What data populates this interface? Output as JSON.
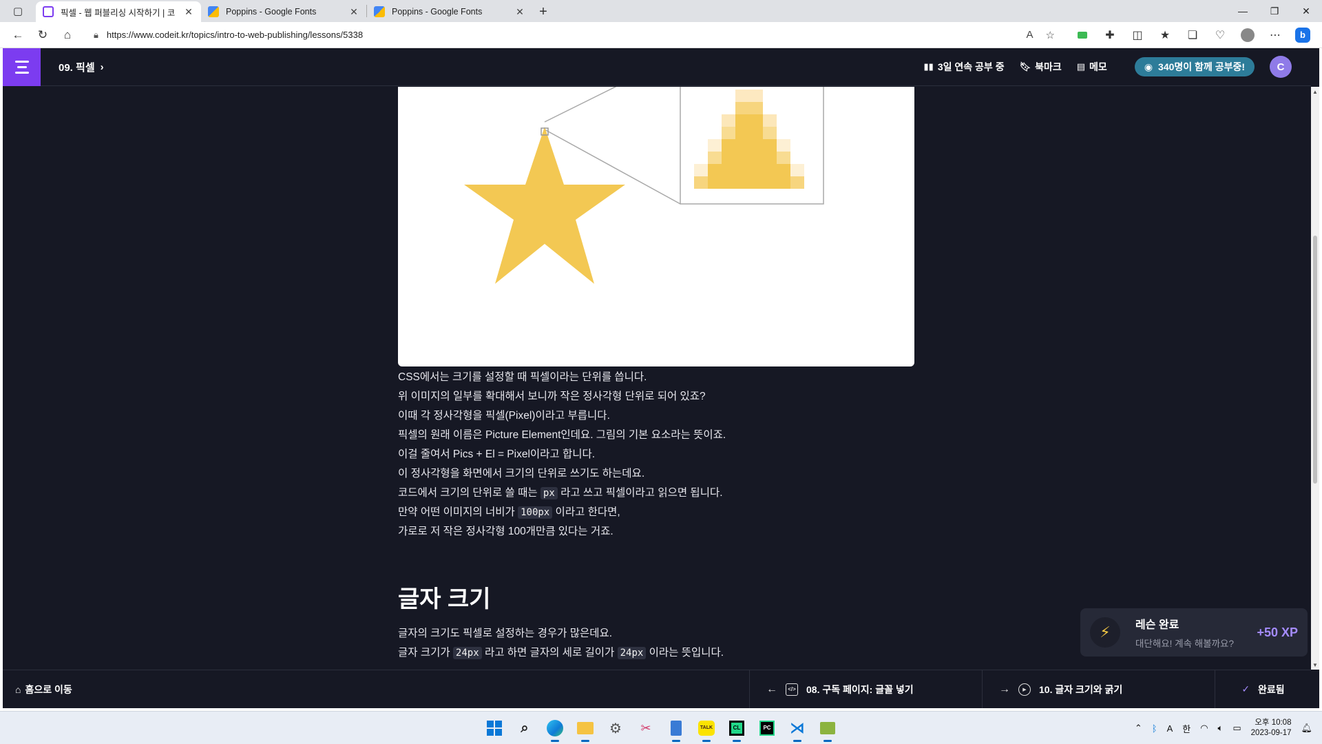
{
  "browser": {
    "tabs": [
      {
        "title": "픽셀 - 웹 퍼블리싱 시작하기 | 코",
        "active": true,
        "favicon_color": "#7c3cf0"
      },
      {
        "title": "Poppins - Google Fonts",
        "active": false,
        "favicon_color": "#4285f4"
      },
      {
        "title": "Poppins - Google Fonts",
        "active": false,
        "favicon_color": "#4285f4"
      }
    ],
    "new_tab": "+",
    "url": "https://www.codeit.kr/topics/intro-to-web-publishing/lessons/5338"
  },
  "header": {
    "chapter": "09. 픽셀",
    "streak": "3일 연속 공부 중",
    "bookmark": "북마크",
    "memo": "메모",
    "studying_now": "340명이 함께 공부중!",
    "avatar_initial": "C"
  },
  "lesson": {
    "paragraph1": [
      "CSS에서는 크기를 설정할 때 픽셀이라는 단위를 씁니다.",
      "위 이미지의 일부를 확대해서 보니까 작은 정사각형 단위로 되어 있죠?",
      "이때 각 정사각형을 픽셀(Pixel)이라고 부릅니다.",
      "픽셀의 원래 이름은 Picture Element인데요. 그림의 기본 요소라는 뜻이죠.",
      "이걸 줄여서 Pics + El = Pixel이라고 합니다.",
      "이 정사각형을 화면에서 크기의 단위로 쓰기도 하는데요."
    ],
    "line_px": {
      "before": "코드에서 크기의 단위로 쓸 때는 ",
      "code": "px",
      "after": " 라고 쓰고 픽셀이라고 읽으면 됩니다."
    },
    "line_width": {
      "before": "만약 어떤 이미지의 너비가 ",
      "code": "100px",
      "after": " 이라고 한다면,"
    },
    "line_last": "가로로 저 작은 정사각형 100개만큼 있다는 거죠.",
    "section_title": "글자 크기",
    "paragraph2_line1": "글자의 크기도 픽셀로 설정하는 경우가 많은데요.",
    "line_24": {
      "before": "글자 크기가 ",
      "code1": "24px",
      "middle": " 라고 하면 글자의 세로 길이가 ",
      "code2": "24px",
      "after": " 이라는 뜻입니다."
    }
  },
  "toast": {
    "title": "레슨 완료",
    "subtitle": "대단해요! 계속 해볼까요?",
    "xp": "+50 XP"
  },
  "footer": {
    "home": "홈으로 이동",
    "prev": "08. 구독 페이지: 글꼴 넣기",
    "next": "10. 글자 크기와 굵기",
    "done": "완료됨"
  },
  "taskbar": {
    "ampm_time": "오후 10:08",
    "date": "2023-09-17",
    "ime_a": "A",
    "ime_han": "한"
  },
  "colors": {
    "accent": "#7c3cf0",
    "page_bg": "#161824",
    "star": "#f3c853",
    "pill": "#2d7c99",
    "xp": "#a58cff"
  }
}
